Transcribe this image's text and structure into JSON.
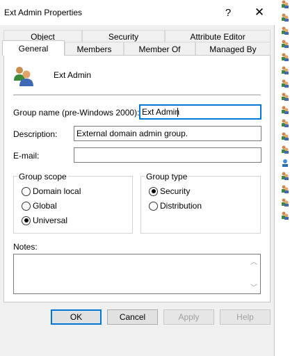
{
  "window": {
    "title": "Ext Admin Properties",
    "help_glyph": "?",
    "close_glyph": "✕"
  },
  "tabs": {
    "row1": [
      "Object",
      "Security",
      "Attribute Editor"
    ],
    "row2": [
      "General",
      "Members",
      "Member Of",
      "Managed By"
    ],
    "active": "General"
  },
  "general": {
    "object_name": "Ext Admin",
    "group_name_label": "Group name (pre-Windows 2000):",
    "group_name_value": "Ext Admin",
    "description_label": "Description:",
    "description_value": "External domain admin group.",
    "email_label": "E-mail:",
    "email_value": "",
    "group_scope": {
      "title": "Group scope",
      "options": [
        "Domain local",
        "Global",
        "Universal"
      ],
      "selected": "Universal"
    },
    "group_type": {
      "title": "Group type",
      "options": [
        "Security",
        "Distribution"
      ],
      "selected": "Security"
    },
    "notes_label": "Notes:",
    "notes_value": ""
  },
  "buttons": {
    "ok": "OK",
    "cancel": "Cancel",
    "apply": "Apply",
    "help": "Help"
  },
  "icons": {
    "group": "group-users-icon",
    "strip": "group-users-icon"
  },
  "colors": {
    "focus_accent": "#0078d7",
    "dialog_bg": "#f0f0f0",
    "panel_bg": "#ffffff"
  }
}
